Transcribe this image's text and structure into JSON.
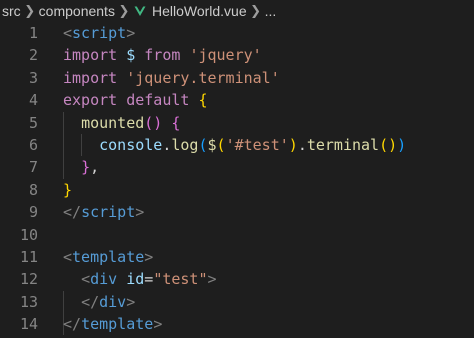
{
  "breadcrumb": {
    "items": [
      "src",
      "components",
      "HelloWorld.vue",
      "..."
    ],
    "separator_icon": "chevron-right-icon",
    "file_icon": "vue-icon",
    "vue_icon_color": "#41b883"
  },
  "theme": {
    "background": "#1e1e1e",
    "line_number_color": "#858585"
  },
  "editor": {
    "line_numbers": [
      "1",
      "2",
      "3",
      "4",
      "5",
      "6",
      "7",
      "8",
      "9",
      "10",
      "11",
      "12",
      "13",
      "14"
    ],
    "lines": [
      [
        {
          "t": "<",
          "c": "punc"
        },
        {
          "t": "script",
          "c": "tag"
        },
        {
          "t": ">",
          "c": "punc"
        }
      ],
      [
        {
          "t": "import",
          "c": "kw"
        },
        {
          "t": " ",
          "c": "ident"
        },
        {
          "t": "$",
          "c": "var"
        },
        {
          "t": " ",
          "c": "ident"
        },
        {
          "t": "from",
          "c": "kw"
        },
        {
          "t": " ",
          "c": "ident"
        },
        {
          "t": "'jquery'",
          "c": "str"
        }
      ],
      [
        {
          "t": "import",
          "c": "kw"
        },
        {
          "t": " ",
          "c": "ident"
        },
        {
          "t": "'jquery.terminal'",
          "c": "str"
        }
      ],
      [
        {
          "t": "export",
          "c": "kw"
        },
        {
          "t": " ",
          "c": "ident"
        },
        {
          "t": "default",
          "c": "kw"
        },
        {
          "t": " ",
          "c": "ident"
        },
        {
          "t": "{",
          "c": "brk1"
        }
      ],
      [
        {
          "t": "  ",
          "c": "ident"
        },
        {
          "t": "mounted",
          "c": "fn"
        },
        {
          "t": "()",
          "c": "brk2"
        },
        {
          "t": " ",
          "c": "ident"
        },
        {
          "t": "{",
          "c": "brk2"
        }
      ],
      [
        {
          "t": "    ",
          "c": "ident"
        },
        {
          "t": "console",
          "c": "var"
        },
        {
          "t": ".",
          "c": "ident"
        },
        {
          "t": "log",
          "c": "fn"
        },
        {
          "t": "(",
          "c": "brk3"
        },
        {
          "t": "$",
          "c": "fn"
        },
        {
          "t": "(",
          "c": "brk1"
        },
        {
          "t": "'#test'",
          "c": "str"
        },
        {
          "t": ")",
          "c": "brk1"
        },
        {
          "t": ".",
          "c": "ident"
        },
        {
          "t": "terminal",
          "c": "fn"
        },
        {
          "t": "()",
          "c": "brk1"
        },
        {
          "t": ")",
          "c": "brk3"
        }
      ],
      [
        {
          "t": "  ",
          "c": "ident"
        },
        {
          "t": "}",
          "c": "brk2"
        },
        {
          "t": ",",
          "c": "ident"
        }
      ],
      [
        {
          "t": "}",
          "c": "brk1"
        }
      ],
      [
        {
          "t": "</",
          "c": "punc"
        },
        {
          "t": "script",
          "c": "tag"
        },
        {
          "t": ">",
          "c": "punc"
        }
      ],
      [],
      [
        {
          "t": "<",
          "c": "punc"
        },
        {
          "t": "template",
          "c": "tag"
        },
        {
          "t": ">",
          "c": "punc"
        }
      ],
      [
        {
          "t": "  ",
          "c": "ident"
        },
        {
          "t": "<",
          "c": "punc"
        },
        {
          "t": "div",
          "c": "tag"
        },
        {
          "t": " ",
          "c": "ident"
        },
        {
          "t": "id",
          "c": "attr"
        },
        {
          "t": "=",
          "c": "eq"
        },
        {
          "t": "\"test\"",
          "c": "str"
        },
        {
          "t": ">",
          "c": "punc"
        }
      ],
      [
        {
          "t": "  ",
          "c": "ident"
        },
        {
          "t": "</",
          "c": "punc"
        },
        {
          "t": "div",
          "c": "tag"
        },
        {
          "t": ">",
          "c": "punc"
        }
      ],
      [
        {
          "t": "</",
          "c": "punc"
        },
        {
          "t": "template",
          "c": "tag"
        },
        {
          "t": ">",
          "c": "punc"
        }
      ]
    ]
  }
}
